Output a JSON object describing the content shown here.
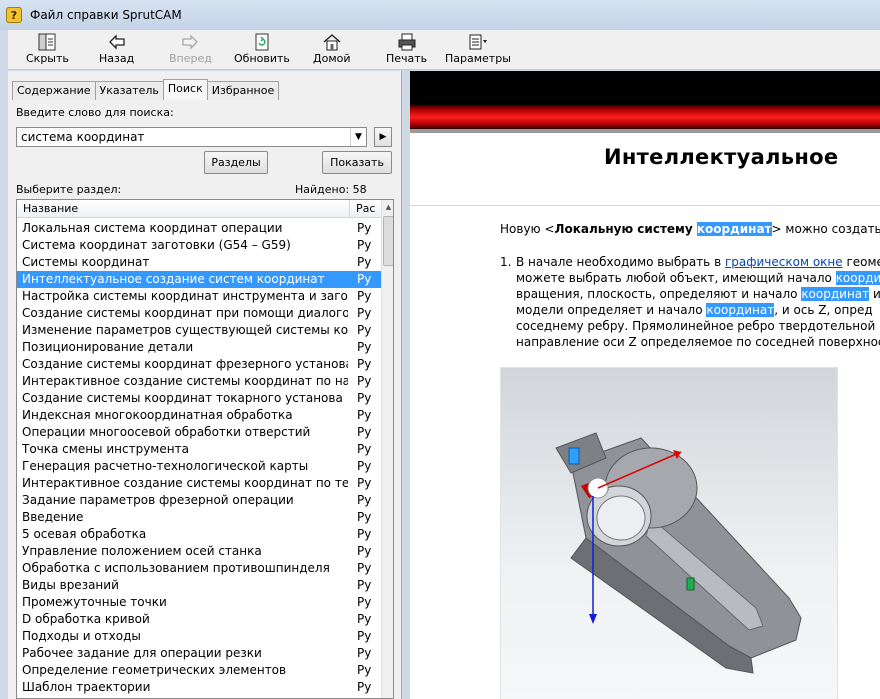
{
  "window": {
    "title": "Файл справки SprutCAM",
    "icon": "help-book-icon"
  },
  "toolbar": {
    "buttons": [
      {
        "label": "Скрыть",
        "icon": "hide-pane-icon",
        "enabled": true
      },
      {
        "label": "Назад",
        "icon": "back-arrow-icon",
        "enabled": true
      },
      {
        "label": "Вперед",
        "icon": "forward-arrow-icon",
        "enabled": false
      },
      {
        "label": "Обновить",
        "icon": "refresh-icon",
        "enabled": true
      },
      {
        "label": "Домой",
        "icon": "home-icon",
        "enabled": true
      },
      {
        "label": "Печать",
        "icon": "printer-icon",
        "enabled": true
      },
      {
        "label": "Параметры",
        "icon": "options-icon",
        "enabled": true
      }
    ]
  },
  "nav": {
    "tabs": [
      "Содержание",
      "Указатель",
      "Поиск",
      "Избранное"
    ],
    "active_tab": "Поиск",
    "search_label": "Введите слово для поиска:",
    "search_value": "система координат",
    "topics_button": "Разделы",
    "show_button": "Показать",
    "select_label": "Выберите раздел:",
    "found_text": "Найдено: 58",
    "columns": [
      "Название",
      "Рас"
    ],
    "selected_index": 3,
    "results": [
      {
        "name": "Локальная система координат операции",
        "lang": "Ру"
      },
      {
        "name": "Система координат заготовки (G54 – G59)",
        "lang": "Ру"
      },
      {
        "name": "Системы координат",
        "lang": "Ру"
      },
      {
        "name": "Интеллектуальное создание систем координат",
        "lang": "Ру"
      },
      {
        "name": "Настройка системы координат инструмента и загото...",
        "lang": "Ру"
      },
      {
        "name": "Создание системы координат при помощи диалогов...",
        "lang": "Ру"
      },
      {
        "name": "Изменение параметров существующей системы ко...",
        "lang": "Ру"
      },
      {
        "name": "Позиционирование детали",
        "lang": "Ру"
      },
      {
        "name": "Создание системы координат фрезерного установа",
        "lang": "Ру"
      },
      {
        "name": "Интерактивное создание системы координат по нач...",
        "lang": "Ру"
      },
      {
        "name": "Создание системы координат токарного установа",
        "lang": "Ру"
      },
      {
        "name": "Индексная многокоординатная обработка",
        "lang": "Ру"
      },
      {
        "name": "Операции многоосевой обработки отверстий",
        "lang": "Ру"
      },
      {
        "name": "Точка смены инструмента",
        "lang": "Ру"
      },
      {
        "name": "Генерация расчетно-технологической карты",
        "lang": "Ру"
      },
      {
        "name": "Интерактивное создание системы координат по теку...",
        "lang": "Ру"
      },
      {
        "name": "Задание параметров фрезерной операции",
        "lang": "Ру"
      },
      {
        "name": "Введение",
        "lang": "Ру"
      },
      {
        "name": "5 осевая обработка",
        "lang": "Ру"
      },
      {
        "name": "Управление положением осей станка",
        "lang": "Ру"
      },
      {
        "name": "Обработка с использованием противошпинделя",
        "lang": "Ру"
      },
      {
        "name": "Виды врезаний",
        "lang": "Ру"
      },
      {
        "name": "Промежуточные точки",
        "lang": "Ру"
      },
      {
        "name": "D обработка кривой",
        "lang": "Ру"
      },
      {
        "name": "Подходы и отходы",
        "lang": "Ру"
      },
      {
        "name": "Рабочее задание для операции резки",
        "lang": "Ру"
      },
      {
        "name": "Определение геометрических элементов",
        "lang": "Ру"
      },
      {
        "name": "Шаблон траектории",
        "lang": "Ру"
      }
    ]
  },
  "content": {
    "title": "Интеллектуальное",
    "intro": {
      "before": "Новую <",
      "bold": "Локальную систему ",
      "hl": "координат",
      "after": "> можно создать все"
    },
    "step_number": "1.",
    "step_lines": [
      [
        {
          "t": "В начале необходимо выбрать в "
        },
        {
          "t": "графическом окне",
          "link": true
        },
        {
          "t": " геомет"
        }
      ],
      [
        {
          "t": "можете выбрать любой объект, имеющий начало "
        },
        {
          "t": "координ",
          "hl": true
        }
      ],
      [
        {
          "t": "вращения, плоскость, определяют и начало "
        },
        {
          "t": "координат",
          "hl": true
        },
        {
          "t": " и"
        }
      ],
      [
        {
          "t": "модели определяет и начало "
        },
        {
          "t": "координат",
          "hl": true
        },
        {
          "t": ", и ось Z, опред"
        }
      ],
      [
        {
          "t": "соседнему ребру. Прямолинейное ребро твердотельной"
        }
      ],
      [
        {
          "t": "направление оси Z определяемое по соседней поверхности"
        }
      ]
    ],
    "figure_colors": {
      "part": "#8f9398",
      "axis_x": "#e00000",
      "axis_z": "#1020d0"
    }
  },
  "colors": {
    "selection": "#3399ff",
    "link": "#0645ad",
    "header_red": "#ff1e1e"
  }
}
